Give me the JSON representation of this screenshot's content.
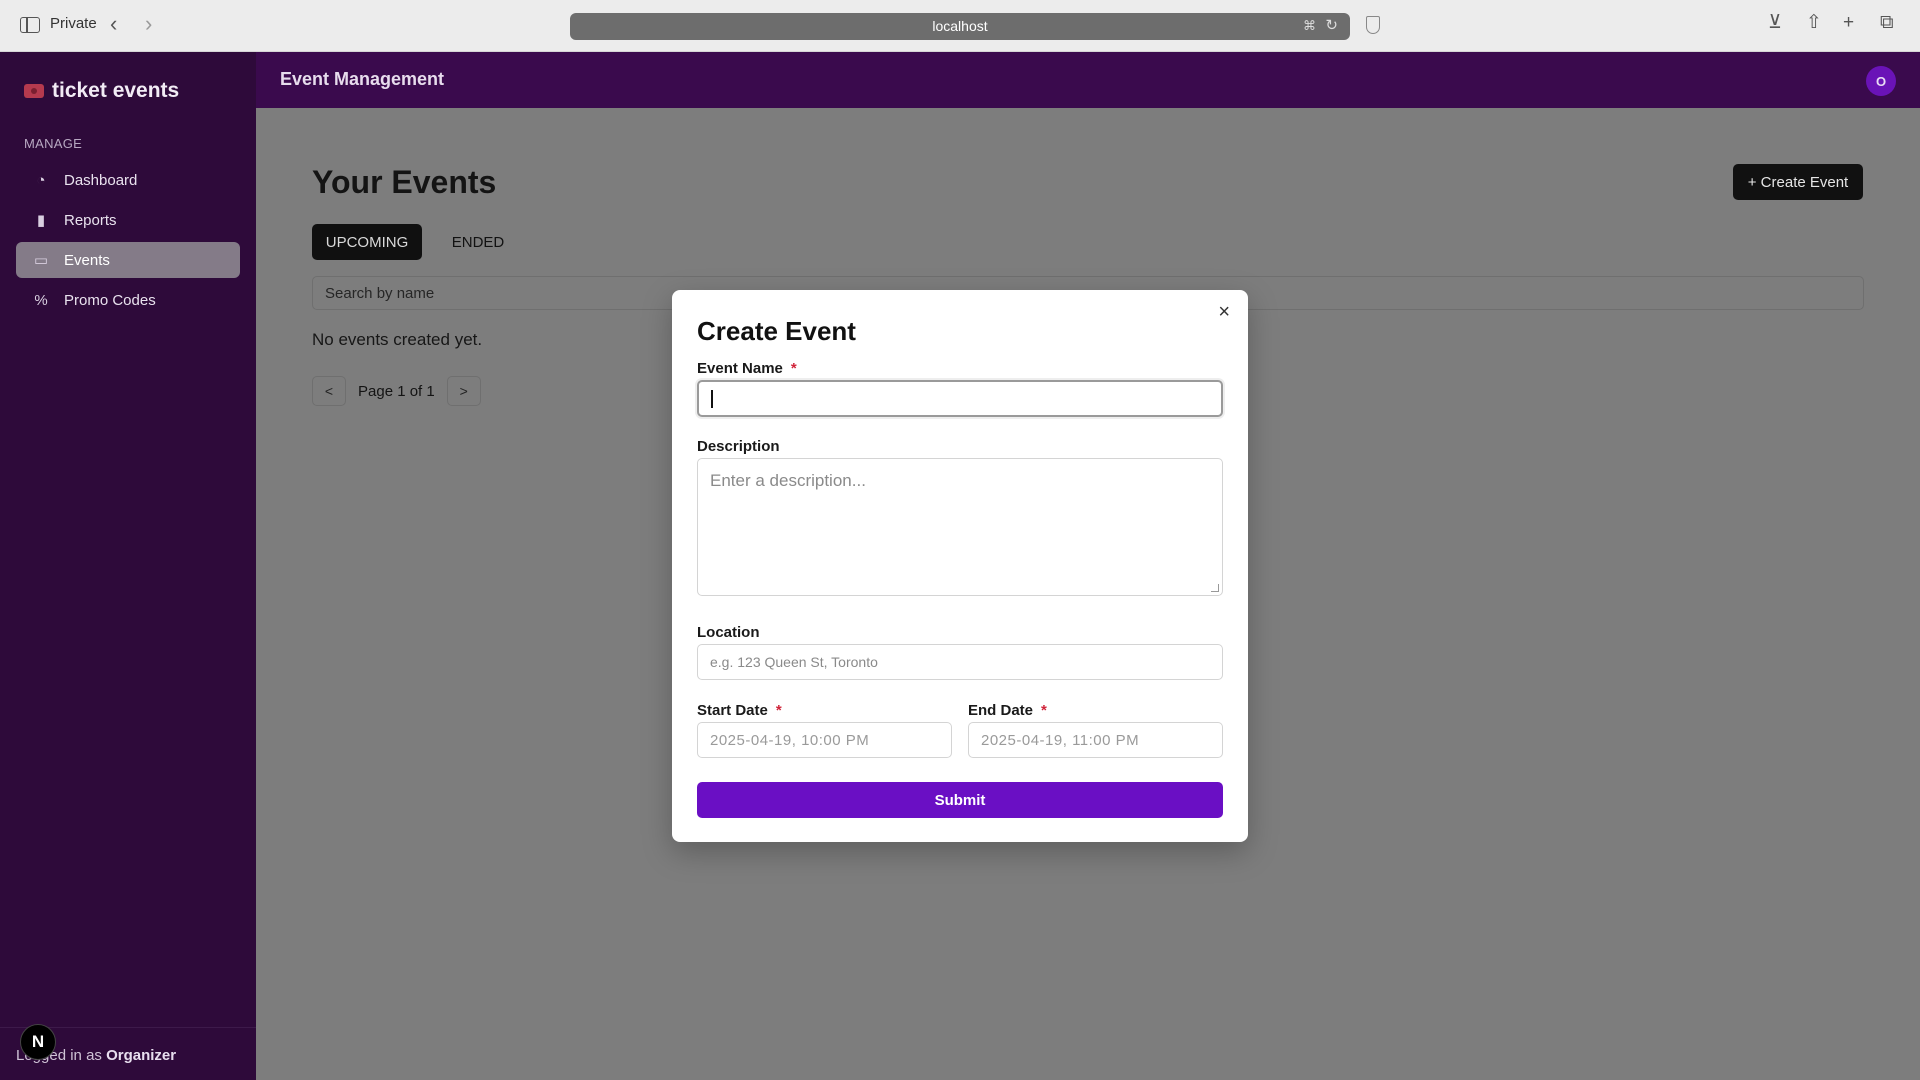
{
  "browser": {
    "mode_label": "Private",
    "url": "localhost"
  },
  "sidebar": {
    "brand": "ticket events",
    "section_label": "MANAGE",
    "items": [
      {
        "label": "Dashboard",
        "icon": "gauge-icon"
      },
      {
        "label": "Reports",
        "icon": "bar-chart-icon"
      },
      {
        "label": "Events",
        "icon": "ticket-icon",
        "active": true
      },
      {
        "label": "Promo Codes",
        "icon": "percent-icon"
      }
    ],
    "logged_in_prefix": "Logged in as",
    "logged_in_user": "Organizer",
    "badge": "N"
  },
  "header": {
    "title": "Event Management",
    "avatar_initial": "O"
  },
  "main": {
    "page_title": "Your Events",
    "create_button": "+ Create Event",
    "tabs": [
      {
        "label": "UPCOMING",
        "active": true
      },
      {
        "label": "ENDED",
        "active": false
      }
    ],
    "search_placeholder": "Search by name",
    "empty_message": "No events created yet.",
    "pager": {
      "prev": "<",
      "next": ">",
      "text": "Page 1 of 1"
    }
  },
  "modal": {
    "title": "Create Event",
    "close": "×",
    "event_name": {
      "label": "Event Name",
      "required_mark": "*",
      "value": ""
    },
    "description": {
      "label": "Description",
      "placeholder": "Enter a description..."
    },
    "location": {
      "label": "Location",
      "placeholder": "e.g. 123 Queen St, Toronto"
    },
    "start_date": {
      "label": "Start Date",
      "required_mark": "*",
      "placeholder": "2025-04-19, 10:00 PM"
    },
    "end_date": {
      "label": "End Date",
      "required_mark": "*",
      "placeholder": "2025-04-19, 11:00 PM"
    },
    "submit": "Submit"
  },
  "colors": {
    "sidebar_bg": "#2e0a3a",
    "header_bg": "#3a0a4d",
    "accent": "#6a0fc4",
    "required": "#d0243a"
  }
}
